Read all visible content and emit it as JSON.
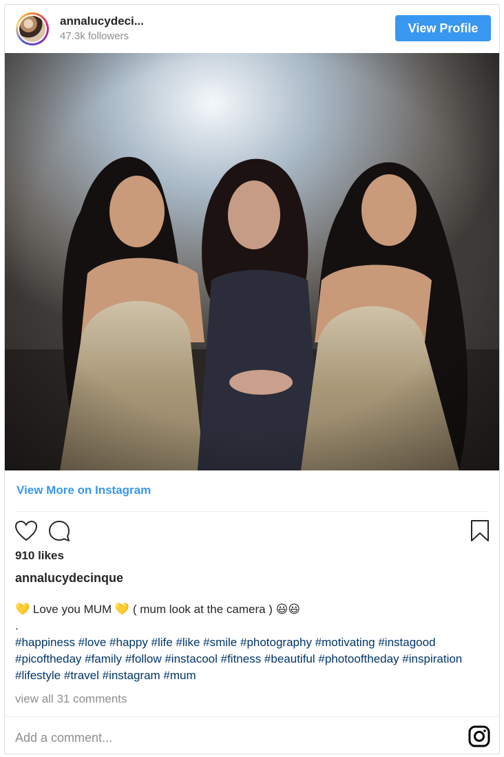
{
  "header": {
    "username": "annalucydeci...",
    "followers": "47.3k followers",
    "view_profile_label": "View Profile"
  },
  "links": {
    "view_more": "View More on Instagram"
  },
  "post": {
    "likes": "910 likes",
    "owner": "annalucydecinque",
    "caption_line1": "💛 Love you MUM 💛 ( mum look at the camera ) 😃😃",
    "caption_dot": ".",
    "hashtags": "#happiness #love #happy #life #like #smile #photography #motivating #instagood #picoftheday #family #follow #instacool #fitness #beautiful #photooftheday #inspiration #lifestyle #travel #instagram #mum",
    "view_comments": "view all 31 comments"
  },
  "comment": {
    "placeholder": "Add a comment..."
  },
  "colors": {
    "accent": "#3897f0",
    "hashtag": "#003569",
    "muted": "#8e8e8e"
  },
  "icons": [
    "heart-icon",
    "comment-icon",
    "bookmark-icon",
    "instagram-icon"
  ]
}
